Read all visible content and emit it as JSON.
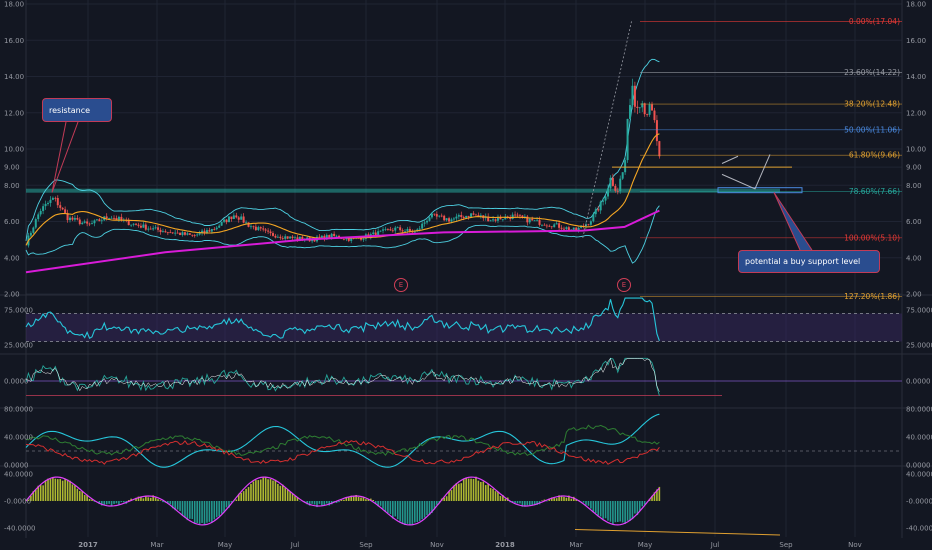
{
  "chart_data": [
    {
      "type": "candlestick",
      "panel": "price",
      "title": "",
      "ylim": [
        2.0,
        18.0
      ],
      "y_ticks": [
        "18.00",
        "16.00",
        "14.00",
        "12.00",
        "10.00",
        "9.00",
        "8.00",
        "6.00",
        "4.00",
        "2.00"
      ],
      "price_path": [
        [
          0.0,
          4.8
        ],
        [
          0.02,
          6.6
        ],
        [
          0.04,
          7.3
        ],
        [
          0.06,
          6.2
        ],
        [
          0.09,
          5.8
        ],
        [
          0.12,
          6.3
        ],
        [
          0.15,
          5.9
        ],
        [
          0.18,
          5.6
        ],
        [
          0.21,
          5.4
        ],
        [
          0.24,
          5.2
        ],
        [
          0.27,
          5.6
        ],
        [
          0.3,
          6.4
        ],
        [
          0.32,
          5.8
        ],
        [
          0.35,
          5.3
        ],
        [
          0.38,
          5.1
        ],
        [
          0.41,
          5.0
        ],
        [
          0.44,
          5.2
        ],
        [
          0.47,
          5.0
        ],
        [
          0.5,
          5.3
        ],
        [
          0.53,
          5.6
        ],
        [
          0.56,
          5.4
        ],
        [
          0.58,
          6.3
        ],
        [
          0.61,
          6.1
        ],
        [
          0.64,
          6.4
        ],
        [
          0.67,
          6.1
        ],
        [
          0.7,
          6.3
        ],
        [
          0.73,
          6.0
        ],
        [
          0.76,
          5.8
        ],
        [
          0.79,
          5.5
        ],
        [
          0.81,
          6.0
        ],
        [
          0.83,
          7.2
        ],
        [
          0.84,
          8.4
        ],
        [
          0.85,
          7.8
        ],
        [
          0.86,
          9.0
        ],
        [
          0.87,
          14.0
        ],
        [
          0.875,
          12.5
        ],
        [
          0.88,
          13.0
        ],
        [
          0.89,
          12.3
        ],
        [
          0.9,
          11.8
        ],
        [
          0.905,
          11.0
        ],
        [
          0.91,
          9.3
        ]
      ],
      "series": [
        {
          "name": "",
          "color": "#d81bd8",
          "path": [
            [
              0.0,
              3.2
            ],
            [
              0.2,
              4.3
            ],
            [
              0.4,
              5.0
            ],
            [
              0.6,
              5.4
            ],
            [
              0.8,
              5.5
            ],
            [
              0.86,
              5.7
            ],
            [
              0.91,
              6.6
            ]
          ]
        }
      ],
      "fibonacci": [
        {
          "label": "0.00%(17.04)",
          "value": 17.04,
          "color": "#e53935"
        },
        {
          "label": "23.60%(14.22)",
          "value": 14.22,
          "color": "#9598a1"
        },
        {
          "label": "38.20%(12.48)",
          "value": 12.48,
          "color": "#e0a030"
        },
        {
          "label": "50.00%(11.06)",
          "value": 11.06,
          "color": "#4a8ae0"
        },
        {
          "label": "61.80%(9.66)",
          "value": 9.66,
          "color": "#e0a030"
        },
        {
          "label": "78.60%(7.66)",
          "value": 7.66,
          "color": "#26a69a"
        },
        {
          "label": "100.00%(5.10)",
          "value": 5.1,
          "color": "#e53935"
        },
        {
          "label": "127.20%(1.86)",
          "value": 1.86,
          "color": "#e0a030"
        }
      ],
      "resistance_level": 7.7,
      "annotations": [
        {
          "text": "resistance",
          "color": "#2a4d8f"
        },
        {
          "text": "potential a buy support level",
          "color": "#2a4d8f"
        }
      ],
      "event_markers": [
        "E",
        "E"
      ]
    },
    {
      "type": "line",
      "panel": "oscillator-1",
      "ylim": [
        15,
        95
      ],
      "y_ticks": [
        "75.0000",
        "25.0000"
      ],
      "levels": [
        70,
        30
      ],
      "series": [
        {
          "name": "",
          "color": "#26c6da"
        }
      ]
    },
    {
      "type": "line",
      "panel": "oscillator-2",
      "ylim": [
        -0.8,
        0.8
      ],
      "y_ticks": [
        "0.0000"
      ],
      "series": [
        {
          "name": "",
          "color": "#26a69a"
        }
      ]
    },
    {
      "type": "line",
      "panel": "oscillator-3",
      "ylim": [
        0,
        80
      ],
      "y_ticks": [
        "80.0000",
        "40.0000",
        "0.0000"
      ],
      "series": [
        {
          "name": "",
          "color": "#26c6da"
        },
        {
          "name": "",
          "color": "#2e7d32"
        },
        {
          "name": "",
          "color": "#d32f2f"
        }
      ]
    },
    {
      "type": "bar",
      "panel": "oscillator-4",
      "ylim": [
        -50,
        50
      ],
      "y_ticks": [
        "40.0000",
        "-0.0000",
        "-40.0000"
      ],
      "series": [
        {
          "name": "",
          "color": "#e040fb"
        }
      ]
    }
  ],
  "x_axis": {
    "labels": [
      "2017",
      "Mar",
      "May",
      "Jul",
      "Sep",
      "Nov",
      "2018",
      "Mar",
      "May",
      "Jul",
      "Sep",
      "Nov"
    ]
  },
  "colors": {
    "background": "#131722",
    "grid": "#1f2433",
    "up": "#26a69a",
    "down": "#ef5350",
    "bollinger": "#4dd0e1",
    "sma": "#f5a623",
    "long_ma": "#d81bd8"
  }
}
